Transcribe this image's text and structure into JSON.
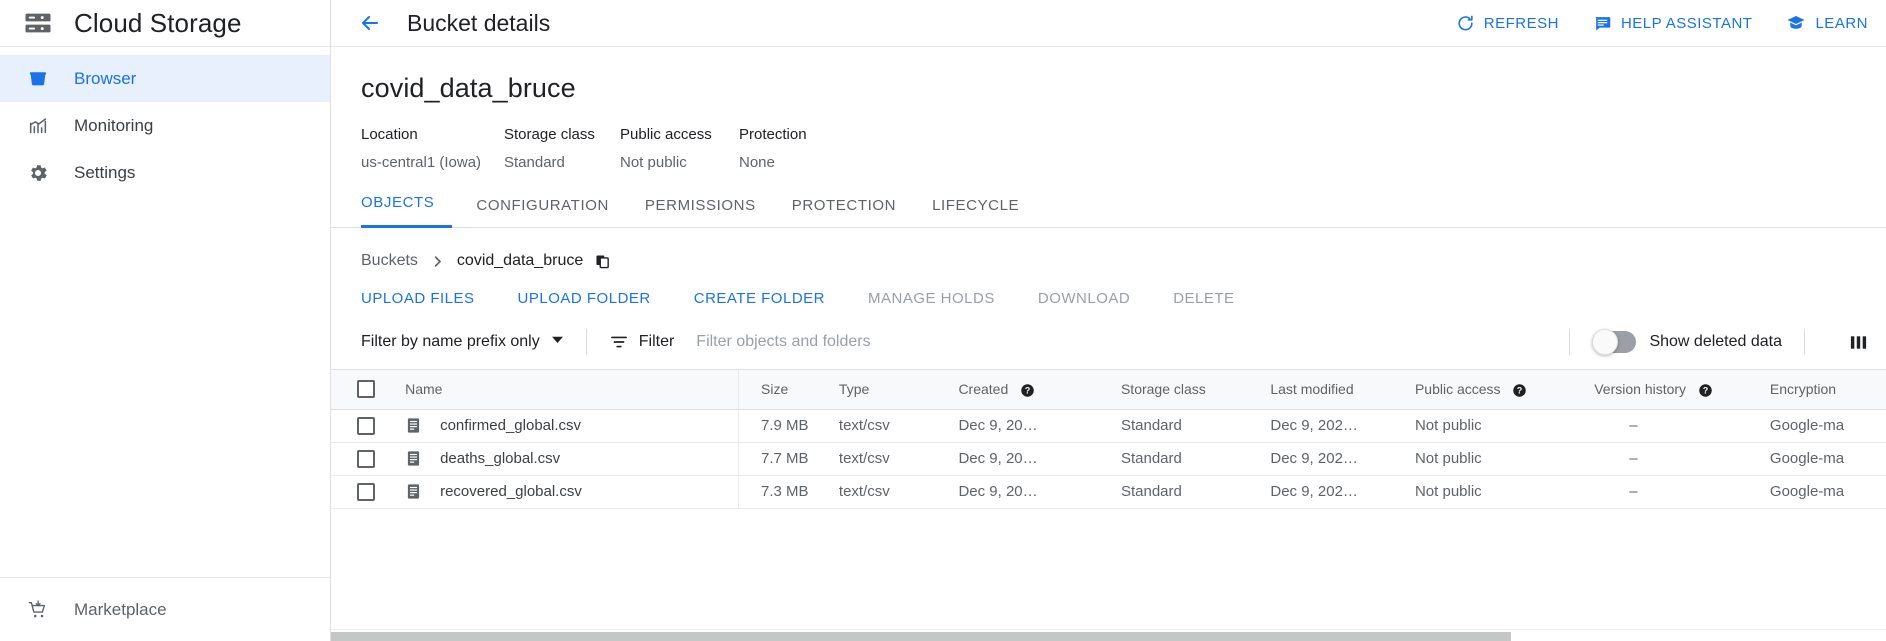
{
  "sidebar": {
    "product_title": "Cloud Storage",
    "product_icon": "storage-icon",
    "items": [
      {
        "label": "Browser",
        "icon": "bucket-icon",
        "active": true
      },
      {
        "label": "Monitoring",
        "icon": "chart-icon",
        "active": false
      },
      {
        "label": "Settings",
        "icon": "gear-icon",
        "active": false
      }
    ],
    "footer": {
      "label": "Marketplace",
      "icon": "cart-icon"
    }
  },
  "topbar": {
    "back_icon": "arrow-left-icon",
    "title": "Bucket details",
    "actions": [
      {
        "label": "REFRESH",
        "icon": "refresh-icon"
      },
      {
        "label": "HELP ASSISTANT",
        "icon": "chat-icon"
      },
      {
        "label": "LEARN",
        "icon": "graduation-cap-icon"
      }
    ]
  },
  "bucket": {
    "name": "covid_data_bruce",
    "meta": [
      {
        "label": "Location",
        "value": "us-central1 (Iowa)"
      },
      {
        "label": "Storage class",
        "value": "Standard"
      },
      {
        "label": "Public access",
        "value": "Not public"
      },
      {
        "label": "Protection",
        "value": "None"
      }
    ]
  },
  "tabs": [
    {
      "label": "OBJECTS",
      "active": true
    },
    {
      "label": "CONFIGURATION",
      "active": false
    },
    {
      "label": "PERMISSIONS",
      "active": false
    },
    {
      "label": "PROTECTION",
      "active": false
    },
    {
      "label": "LIFECYCLE",
      "active": false
    }
  ],
  "breadcrumb": {
    "root": "Buckets",
    "separator": "›",
    "current": "covid_data_bruce",
    "copy_icon": "copy-icon"
  },
  "object_actions": [
    {
      "label": "UPLOAD FILES",
      "enabled": true
    },
    {
      "label": "UPLOAD FOLDER",
      "enabled": true
    },
    {
      "label": "CREATE FOLDER",
      "enabled": true
    },
    {
      "label": "MANAGE HOLDS",
      "enabled": false
    },
    {
      "label": "DOWNLOAD",
      "enabled": false
    },
    {
      "label": "DELETE",
      "enabled": false
    }
  ],
  "filterbar": {
    "prefix_mode": "Filter by name prefix only",
    "caret_icon": "chevron-down-icon",
    "filter_icon": "filter-icon",
    "filter_label": "Filter",
    "filter_value": "",
    "filter_placeholder": "Filter objects and folders",
    "toggle_label": "Show deleted data",
    "toggle_on": false,
    "columns_icon": "columns-icon"
  },
  "table": {
    "columns": [
      {
        "key": "check",
        "label": ""
      },
      {
        "key": "name",
        "label": "Name"
      },
      {
        "key": "size",
        "label": "Size"
      },
      {
        "key": "type",
        "label": "Type"
      },
      {
        "key": "created",
        "label": "Created",
        "help": true
      },
      {
        "key": "storage_class",
        "label": "Storage class"
      },
      {
        "key": "last_modified",
        "label": "Last modified"
      },
      {
        "key": "public_access",
        "label": "Public access",
        "help": true
      },
      {
        "key": "version_history",
        "label": "Version history",
        "help": true
      },
      {
        "key": "encryption",
        "label": "Encryption"
      }
    ],
    "rows": [
      {
        "name": "confirmed_global.csv",
        "icon": "file-icon",
        "size": "7.9 MB",
        "type": "text/csv",
        "created": "Dec 9, 20…",
        "storage_class": "Standard",
        "last_modified": "Dec 9, 202…",
        "public_access": "Not public",
        "version_history": "–",
        "encryption": "Google-ma",
        "download_icon": "download-icon"
      },
      {
        "name": "deaths_global.csv",
        "icon": "file-icon",
        "size": "7.7 MB",
        "type": "text/csv",
        "created": "Dec 9, 20…",
        "storage_class": "Standard",
        "last_modified": "Dec 9, 202…",
        "public_access": "Not public",
        "version_history": "–",
        "encryption": "Google-ma",
        "download_icon": "download-icon"
      },
      {
        "name": "recovered_global.csv",
        "icon": "file-icon",
        "size": "7.3 MB",
        "type": "text/csv",
        "created": "Dec 9, 20…",
        "storage_class": "Standard",
        "last_modified": "Dec 9, 202…",
        "public_access": "Not public",
        "version_history": "–",
        "encryption": "Google-ma",
        "download_icon": "download-icon"
      }
    ]
  },
  "colors": {
    "accent": "#1a73e8",
    "active_nav_bg": "#e8f0fe",
    "text_primary": "#202124",
    "text_secondary": "#5f6368",
    "disabled": "#9aa0a6",
    "table_header_bg": "#f8f9fa",
    "border": "#e0e0e0"
  }
}
